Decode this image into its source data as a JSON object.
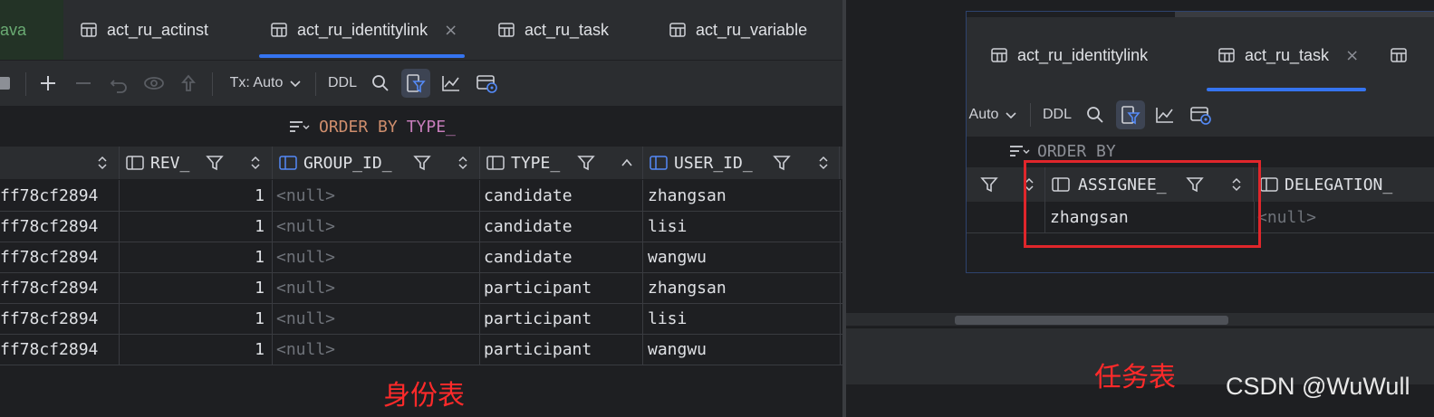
{
  "left": {
    "tab_fragment": "ava",
    "tabs": [
      {
        "label": "act_ru_actinst"
      },
      {
        "label": "act_ru_identitylink",
        "close": "×"
      },
      {
        "label": "act_ru_task"
      },
      {
        "label": "act_ru_variable"
      }
    ],
    "toolbar": {
      "tx": "Tx: Auto",
      "ddl": "DDL"
    },
    "order_by": {
      "keyword": "ORDER BY",
      "column": "TYPE_"
    },
    "columns": [
      {
        "name": "REV_"
      },
      {
        "name": "GROUP_ID_"
      },
      {
        "name": "TYPE_"
      },
      {
        "name": "USER_ID_"
      }
    ],
    "rows": [
      {
        "id": "ff78cf2894",
        "rev": "1",
        "group": "<null>",
        "type": "candidate",
        "user": "zhangsan"
      },
      {
        "id": "ff78cf2894",
        "rev": "1",
        "group": "<null>",
        "type": "candidate",
        "user": "lisi"
      },
      {
        "id": "ff78cf2894",
        "rev": "1",
        "group": "<null>",
        "type": "candidate",
        "user": "wangwu"
      },
      {
        "id": "ff78cf2894",
        "rev": "1",
        "group": "<null>",
        "type": "participant",
        "user": "zhangsan"
      },
      {
        "id": "ff78cf2894",
        "rev": "1",
        "group": "<null>",
        "type": "participant",
        "user": "lisi"
      },
      {
        "id": "ff78cf2894",
        "rev": "1",
        "group": "<null>",
        "type": "participant",
        "user": "wangwu"
      }
    ],
    "caption": "身份表"
  },
  "right": {
    "tabs": [
      {
        "label": "act_ru_identitylink"
      },
      {
        "label": "act_ru_task",
        "close": "×"
      }
    ],
    "toolbar": {
      "tx_fragment": "Auto",
      "ddl": "DDL"
    },
    "order_by": {
      "keyword": "ORDER BY"
    },
    "columns": [
      {
        "name": "ASSIGNEE_"
      },
      {
        "name": "DELEGATION_"
      }
    ],
    "row": {
      "assignee": "zhangsan",
      "delegation": "<null>"
    },
    "caption": "任务表",
    "watermark": "CSDN @WuWull"
  },
  "colors": {
    "accent": "#3574f0",
    "annotation_red": "#e0262b",
    "null_gray": "#6f737a",
    "keyword_orange": "#cf8e6d",
    "identifier_purple": "#c77dbb"
  },
  "icons": [
    "table-icon",
    "close-icon",
    "stop-icon",
    "add-icon",
    "remove-icon",
    "revert-icon",
    "view-icon",
    "submit-icon",
    "chevron-down-icon",
    "search-icon",
    "filter-icon",
    "chart-icon",
    "data-source-icon",
    "sort-icon",
    "column-icon",
    "funnel-icon",
    "sort-arrows-icon",
    "sort-asc-icon"
  ]
}
